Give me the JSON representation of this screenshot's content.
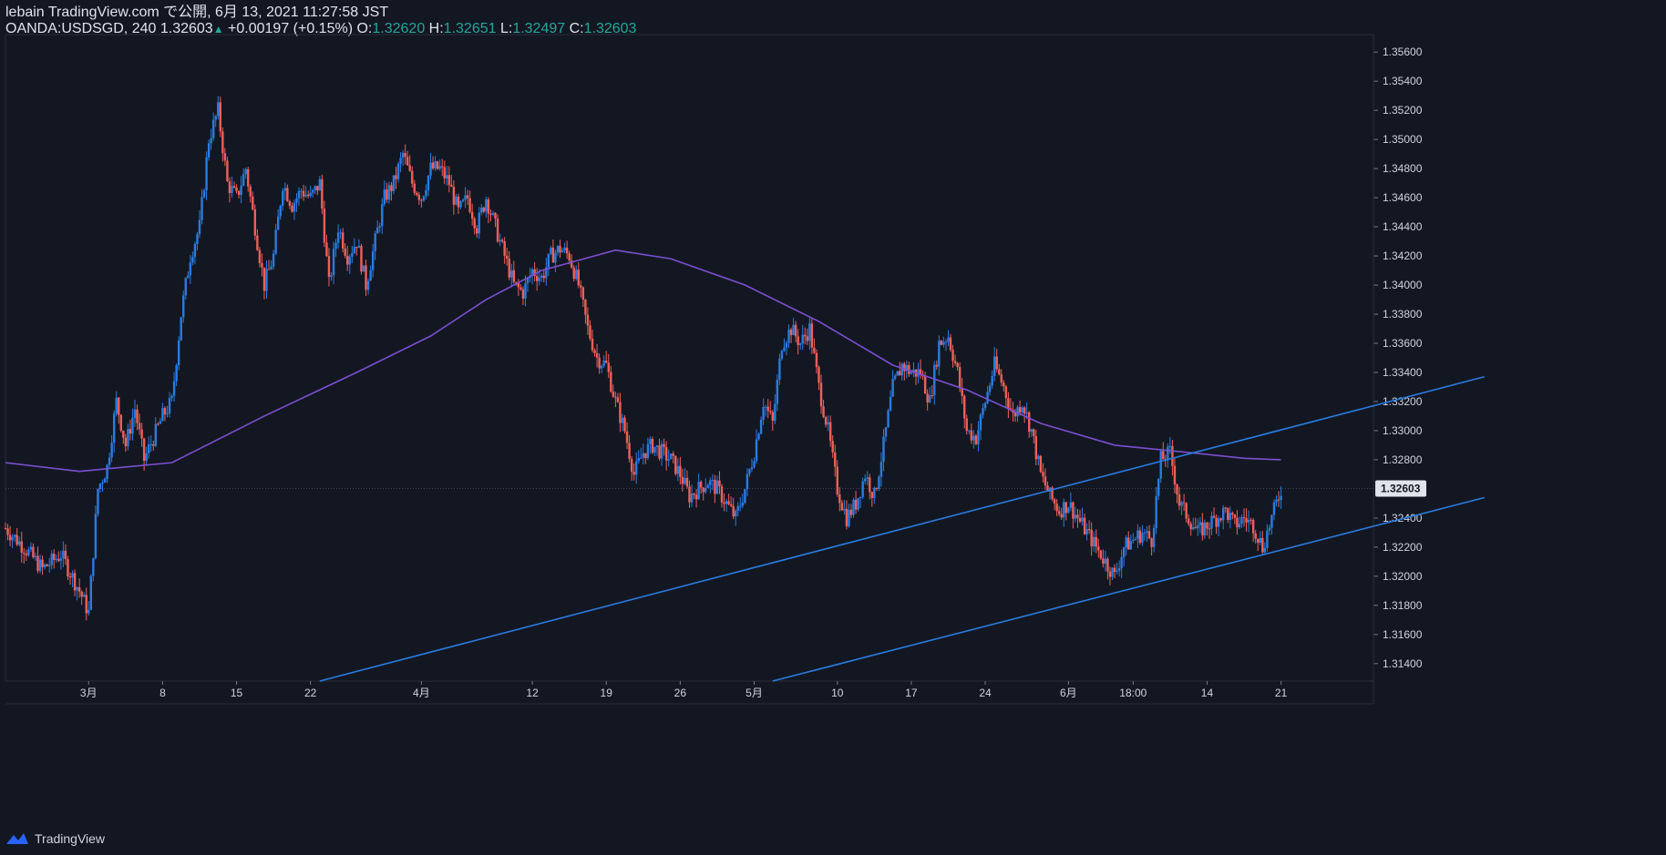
{
  "header": {
    "line1": "lebain TradingView.com で公開, 6月 13, 2021 11:27:58 JST",
    "symbol": "OANDA:USDSGD, 240",
    "last": "1.32603",
    "change": "+0.00197 (+0.15%)",
    "o_label": "O:",
    "o_val": "1.32620",
    "h_label": "H:",
    "h_val": "1.32651",
    "l_label": "L:",
    "l_val": "1.32497",
    "c_label": "C:",
    "c_val": "1.32603"
  },
  "footer": {
    "brand": "TradingView",
    "icon": "tradingview-logo-icon"
  },
  "colors": {
    "background": "#131722",
    "up": "#2a7ce0",
    "down": "#f0605a",
    "ma": "#7b4fd0",
    "trendline": "#2a7ce0",
    "grid": "#1e2230",
    "price_label_bg": "#e0e3eb"
  },
  "chart_data": {
    "type": "candlestick",
    "symbol": "OANDA:USDSGD",
    "timeframe": "240",
    "y_axis": {
      "ticks": [
        "1.35600",
        "1.35400",
        "1.35200",
        "1.35000",
        "1.34800",
        "1.34600",
        "1.34400",
        "1.34200",
        "1.34000",
        "1.33800",
        "1.33600",
        "1.33400",
        "1.33200",
        "1.33000",
        "1.32800",
        "1.32400",
        "1.32200",
        "1.32000",
        "1.31800",
        "1.31600",
        "1.31400"
      ],
      "current_price_label": "1.32603",
      "ylim": [
        1.3128,
        1.3572
      ]
    },
    "x_axis": {
      "ticks": [
        "3月",
        "8",
        "15",
        "22",
        "4月",
        "12",
        "19",
        "26",
        "5月",
        "10",
        "17",
        "24",
        "6月",
        "18:00",
        "14",
        "21"
      ]
    },
    "price_path": [
      {
        "t": 0,
        "p": 1.3233
      },
      {
        "t": 2,
        "p": 1.322
      },
      {
        "t": 4,
        "p": 1.3205
      },
      {
        "t": 6,
        "p": 1.3215
      },
      {
        "t": 8,
        "p": 1.319
      },
      {
        "t": 9,
        "p": 1.3175
      },
      {
        "t": 10,
        "p": 1.326
      },
      {
        "t": 11,
        "p": 1.3275
      },
      {
        "t": 12,
        "p": 1.332
      },
      {
        "t": 13,
        "p": 1.329
      },
      {
        "t": 14,
        "p": 1.3315
      },
      {
        "t": 15,
        "p": 1.328
      },
      {
        "t": 16,
        "p": 1.3295
      },
      {
        "t": 17,
        "p": 1.331
      },
      {
        "t": 18,
        "p": 1.332
      },
      {
        "t": 19,
        "p": 1.338
      },
      {
        "t": 20,
        "p": 1.342
      },
      {
        "t": 21,
        "p": 1.344
      },
      {
        "t": 22,
        "p": 1.35
      },
      {
        "t": 23,
        "p": 1.352
      },
      {
        "t": 24,
        "p": 1.347
      },
      {
        "t": 25,
        "p": 1.346
      },
      {
        "t": 26,
        "p": 1.348
      },
      {
        "t": 27,
        "p": 1.344
      },
      {
        "t": 28,
        "p": 1.34
      },
      {
        "t": 29,
        "p": 1.342
      },
      {
        "t": 30,
        "p": 1.347
      },
      {
        "t": 31,
        "p": 1.3455
      },
      {
        "t": 32,
        "p": 1.3465
      },
      {
        "t": 33,
        "p": 1.346
      },
      {
        "t": 34,
        "p": 1.347
      },
      {
        "t": 35,
        "p": 1.34
      },
      {
        "t": 36,
        "p": 1.344
      },
      {
        "t": 37,
        "p": 1.342
      },
      {
        "t": 38,
        "p": 1.343
      },
      {
        "t": 39,
        "p": 1.34
      },
      {
        "t": 40,
        "p": 1.343
      },
      {
        "t": 41,
        "p": 1.346
      },
      {
        "t": 42,
        "p": 1.347
      },
      {
        "t": 43,
        "p": 1.349
      },
      {
        "t": 44,
        "p": 1.347
      },
      {
        "t": 45,
        "p": 1.346
      },
      {
        "t": 46,
        "p": 1.348
      },
      {
        "t": 47,
        "p": 1.348
      },
      {
        "t": 48,
        "p": 1.347
      },
      {
        "t": 49,
        "p": 1.345
      },
      {
        "t": 50,
        "p": 1.346
      },
      {
        "t": 51,
        "p": 1.344
      },
      {
        "t": 52,
        "p": 1.346
      },
      {
        "t": 53,
        "p": 1.344
      },
      {
        "t": 54,
        "p": 1.342
      },
      {
        "t": 55,
        "p": 1.34
      },
      {
        "t": 56,
        "p": 1.3395
      },
      {
        "t": 57,
        "p": 1.341
      },
      {
        "t": 58,
        "p": 1.3405
      },
      {
        "t": 59,
        "p": 1.342
      },
      {
        "t": 60,
        "p": 1.3425
      },
      {
        "t": 61,
        "p": 1.342
      },
      {
        "t": 62,
        "p": 1.34
      },
      {
        "t": 63,
        "p": 1.337
      },
      {
        "t": 64,
        "p": 1.335
      },
      {
        "t": 65,
        "p": 1.3345
      },
      {
        "t": 66,
        "p": 1.332
      },
      {
        "t": 67,
        "p": 1.33
      },
      {
        "t": 68,
        "p": 1.327
      },
      {
        "t": 69,
        "p": 1.3285
      },
      {
        "t": 70,
        "p": 1.329
      },
      {
        "t": 71,
        "p": 1.3285
      },
      {
        "t": 72,
        "p": 1.328
      },
      {
        "t": 73,
        "p": 1.327
      },
      {
        "t": 74,
        "p": 1.3255
      },
      {
        "t": 75,
        "p": 1.326
      },
      {
        "t": 76,
        "p": 1.3265
      },
      {
        "t": 77,
        "p": 1.326
      },
      {
        "t": 78,
        "p": 1.325
      },
      {
        "t": 79,
        "p": 1.324
      },
      {
        "t": 80,
        "p": 1.326
      },
      {
        "t": 81,
        "p": 1.3285
      },
      {
        "t": 82,
        "p": 1.332
      },
      {
        "t": 83,
        "p": 1.3305
      },
      {
        "t": 84,
        "p": 1.336
      },
      {
        "t": 85,
        "p": 1.337
      },
      {
        "t": 86,
        "p": 1.336
      },
      {
        "t": 87,
        "p": 1.337
      },
      {
        "t": 88,
        "p": 1.333
      },
      {
        "t": 89,
        "p": 1.33
      },
      {
        "t": 90,
        "p": 1.326
      },
      {
        "t": 91,
        "p": 1.324
      },
      {
        "t": 92,
        "p": 1.325
      },
      {
        "t": 93,
        "p": 1.327
      },
      {
        "t": 94,
        "p": 1.3255
      },
      {
        "t": 95,
        "p": 1.329
      },
      {
        "t": 96,
        "p": 1.333
      },
      {
        "t": 97,
        "p": 1.3345
      },
      {
        "t": 98,
        "p": 1.334
      },
      {
        "t": 99,
        "p": 1.334
      },
      {
        "t": 100,
        "p": 1.332
      },
      {
        "t": 101,
        "p": 1.336
      },
      {
        "t": 102,
        "p": 1.3365
      },
      {
        "t": 103,
        "p": 1.334
      },
      {
        "t": 104,
        "p": 1.33
      },
      {
        "t": 105,
        "p": 1.3295
      },
      {
        "t": 106,
        "p": 1.332
      },
      {
        "t": 107,
        "p": 1.3345
      },
      {
        "t": 108,
        "p": 1.333
      },
      {
        "t": 109,
        "p": 1.331
      },
      {
        "t": 110,
        "p": 1.332
      },
      {
        "t": 111,
        "p": 1.33
      },
      {
        "t": 112,
        "p": 1.327
      },
      {
        "t": 113,
        "p": 1.3255
      },
      {
        "t": 114,
        "p": 1.3245
      },
      {
        "t": 115,
        "p": 1.325
      },
      {
        "t": 116,
        "p": 1.324
      },
      {
        "t": 117,
        "p": 1.323
      },
      {
        "t": 118,
        "p": 1.322
      },
      {
        "t": 119,
        "p": 1.321
      },
      {
        "t": 120,
        "p": 1.32
      },
      {
        "t": 121,
        "p": 1.322
      },
      {
        "t": 122,
        "p": 1.3225
      },
      {
        "t": 123,
        "p": 1.323
      },
      {
        "t": 124,
        "p": 1.3225
      },
      {
        "t": 125,
        "p": 1.328
      },
      {
        "t": 126,
        "p": 1.3285
      },
      {
        "t": 127,
        "p": 1.325
      },
      {
        "t": 128,
        "p": 1.324
      },
      {
        "t": 129,
        "p": 1.323
      },
      {
        "t": 130,
        "p": 1.3235
      },
      {
        "t": 131,
        "p": 1.324
      },
      {
        "t": 132,
        "p": 1.3245
      },
      {
        "t": 133,
        "p": 1.3235
      },
      {
        "t": 134,
        "p": 1.324
      },
      {
        "t": 135,
        "p": 1.3235
      },
      {
        "t": 136,
        "p": 1.322
      },
      {
        "t": 137,
        "p": 1.324
      },
      {
        "t": 138,
        "p": 1.326
      }
    ],
    "ma_path": [
      {
        "t": 0,
        "p": 1.3278
      },
      {
        "t": 8,
        "p": 1.3272
      },
      {
        "t": 18,
        "p": 1.3278
      },
      {
        "t": 28,
        "p": 1.331
      },
      {
        "t": 38,
        "p": 1.334
      },
      {
        "t": 46,
        "p": 1.3365
      },
      {
        "t": 52,
        "p": 1.339
      },
      {
        "t": 58,
        "p": 1.341
      },
      {
        "t": 66,
        "p": 1.3424
      },
      {
        "t": 72,
        "p": 1.3418
      },
      {
        "t": 80,
        "p": 1.34
      },
      {
        "t": 88,
        "p": 1.3375
      },
      {
        "t": 96,
        "p": 1.3345
      },
      {
        "t": 104,
        "p": 1.3328
      },
      {
        "t": 112,
        "p": 1.3305
      },
      {
        "t": 120,
        "p": 1.329
      },
      {
        "t": 128,
        "p": 1.3285
      },
      {
        "t": 134,
        "p": 1.3281
      },
      {
        "t": 138,
        "p": 1.328
      }
    ],
    "trendlines": [
      {
        "name": "upper",
        "from": {
          "t": 34,
          "p": 1.3128
        },
        "to": {
          "t": 160,
          "p": 1.3337
        }
      },
      {
        "name": "lower",
        "from": {
          "t": 83,
          "p": 1.3128
        },
        "to": {
          "t": 160,
          "p": 1.3254
        }
      }
    ],
    "x_ticks_t": [
      9,
      17,
      25,
      33,
      45,
      57,
      65,
      73,
      81,
      90,
      98,
      106,
      115,
      122,
      130,
      138
    ],
    "x_range": [
      0,
      148
    ]
  }
}
